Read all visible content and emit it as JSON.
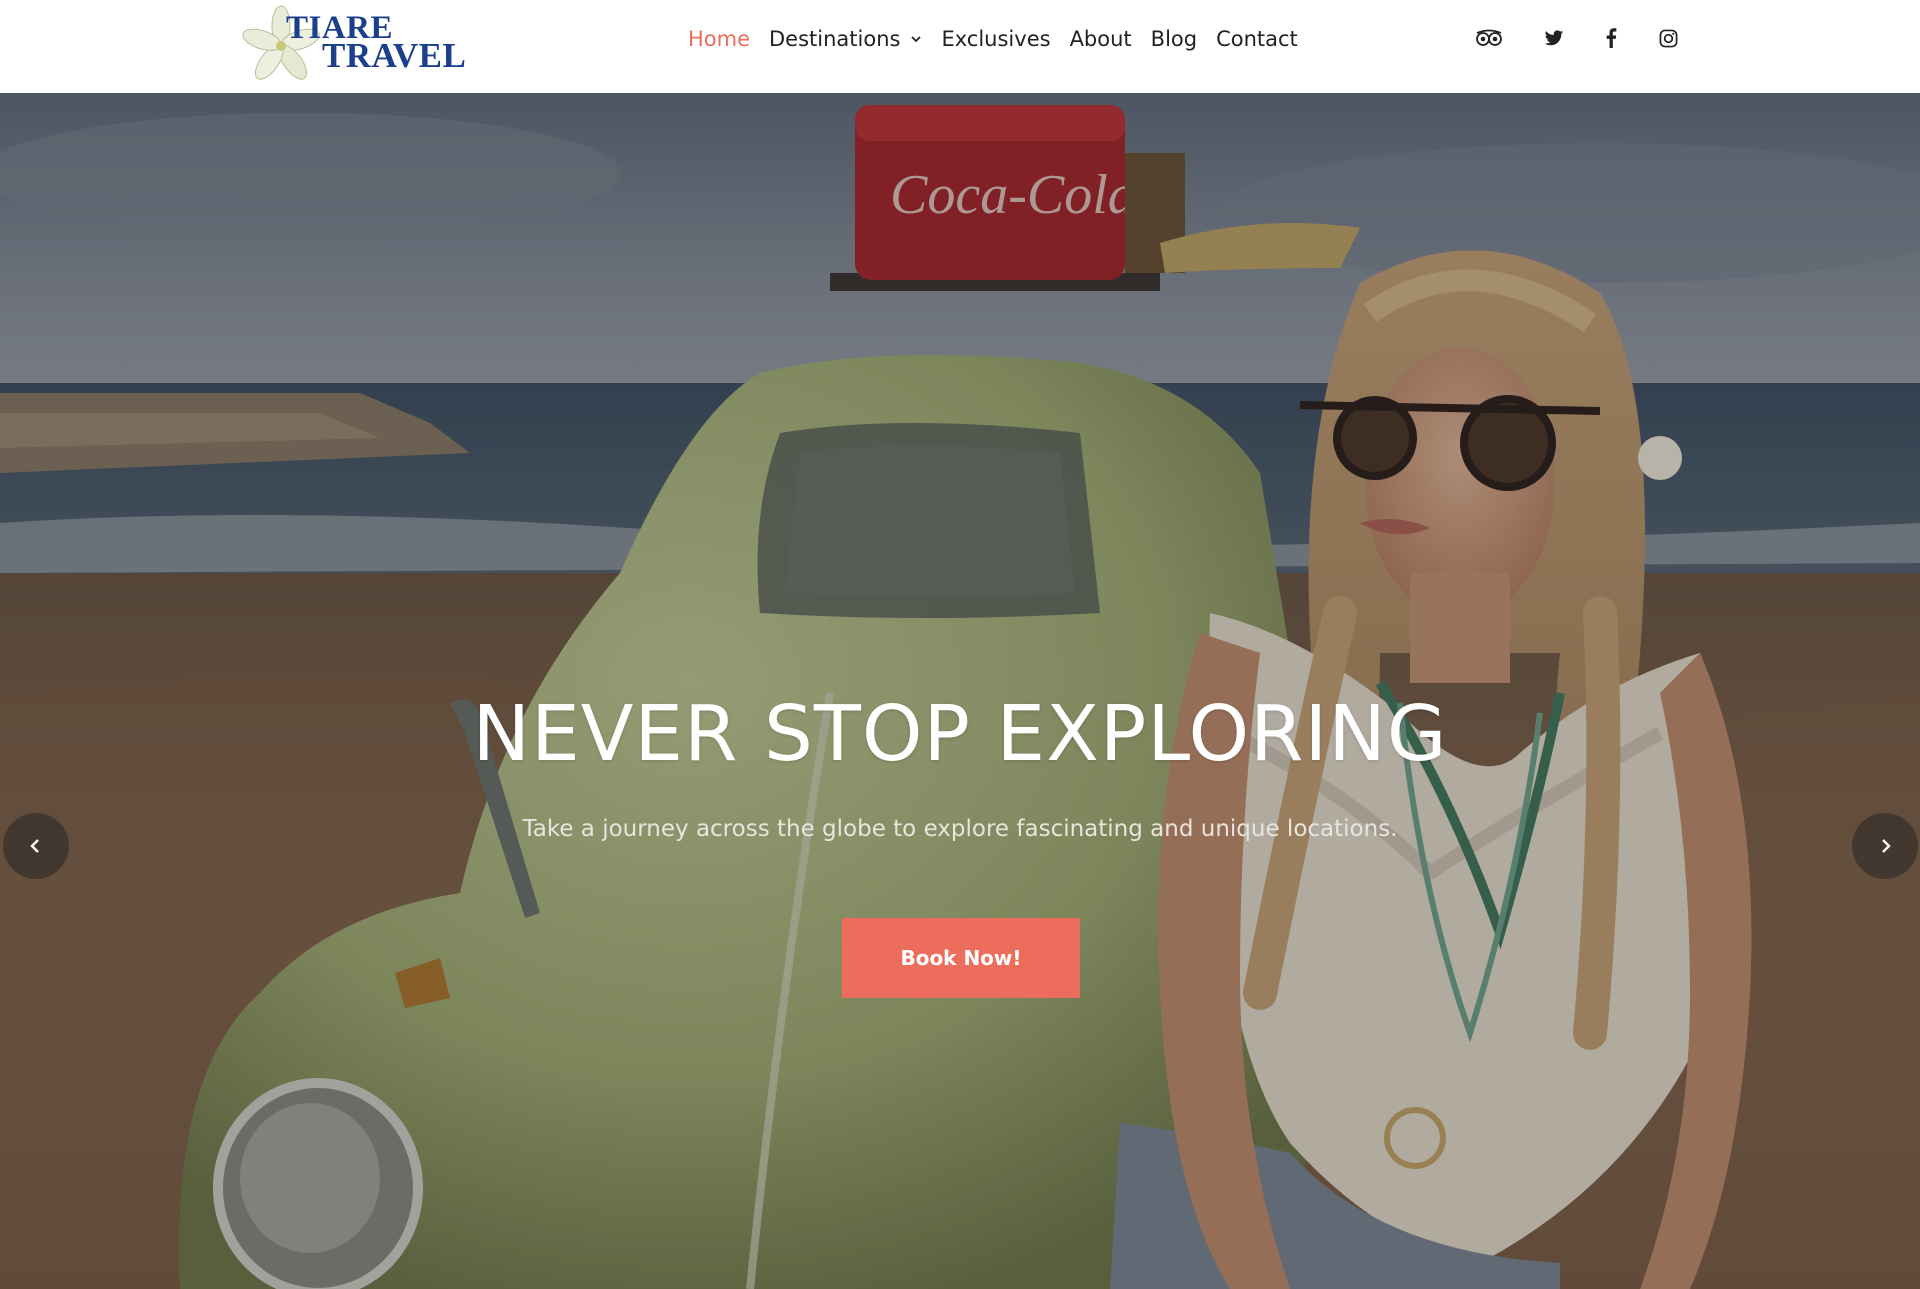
{
  "brand": {
    "logo_line1": "TIARE",
    "logo_line2": "TRAVEL",
    "logo_color": "#1c3f8c"
  },
  "nav": {
    "items": [
      {
        "label": "Home",
        "active": true
      },
      {
        "label": "Destinations",
        "has_dropdown": true,
        "icon": "chevron-down-icon"
      },
      {
        "label": "Exclusives"
      },
      {
        "label": "About"
      },
      {
        "label": "Blog"
      },
      {
        "label": "Contact"
      }
    ],
    "active_color": "#ec6d5b"
  },
  "social": [
    {
      "name": "tripadvisor-icon"
    },
    {
      "name": "twitter-icon"
    },
    {
      "name": "facebook-icon"
    },
    {
      "name": "instagram-icon"
    }
  ],
  "hero": {
    "title": "NEVER STOP EXPLORING",
    "subtitle": "Take a journey across the globe to explore fascinating and unique locations.",
    "cta_label": "Book Now!",
    "cta_color": "#ec6d5b",
    "prev_icon": "chevron-left-icon",
    "next_icon": "chevron-right-icon"
  }
}
